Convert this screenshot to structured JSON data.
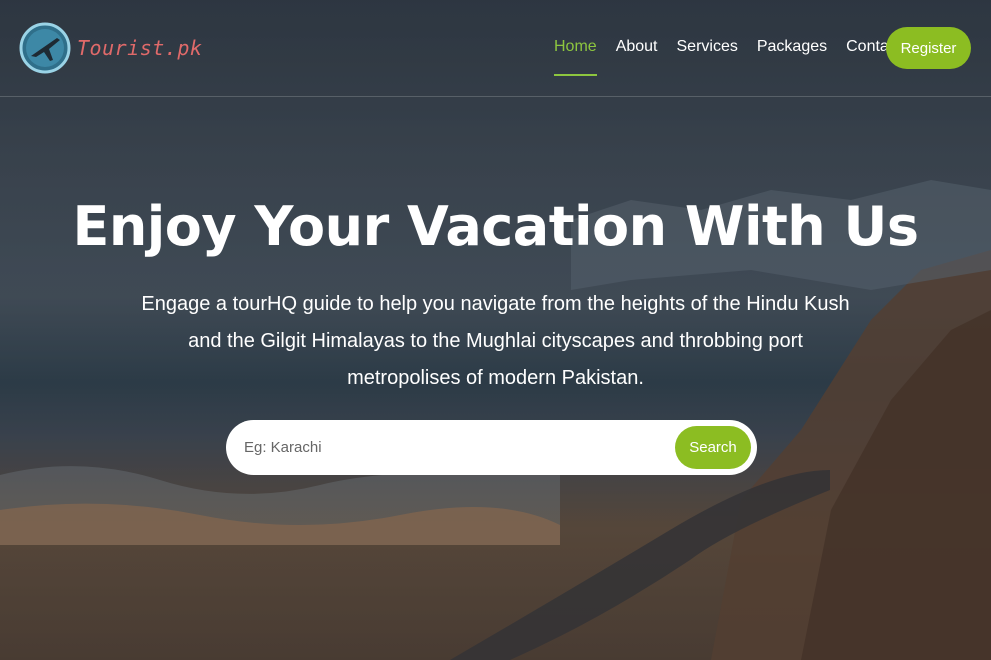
{
  "brand": {
    "name": "Tourist.pk",
    "logo_icon": "airplane-globe-icon"
  },
  "nav": {
    "items": [
      {
        "label": "Home",
        "active": true
      },
      {
        "label": "About",
        "active": false
      },
      {
        "label": "Services",
        "active": false
      },
      {
        "label": "Packages",
        "active": false
      },
      {
        "label": "Contact",
        "active": false
      }
    ],
    "register_label": "Register"
  },
  "hero": {
    "title": "Enjoy Your Vacation With Us",
    "subtitle": "Engage a tourHQ guide to help you navigate from the heights of the Hindu Kush and the Gilgit Himalayas to the Mughlai cityscapes and throbbing port metropolises of modern Pakistan."
  },
  "search": {
    "placeholder": "Eg: Karachi",
    "value": "",
    "button_label": "Search"
  },
  "colors": {
    "accent": "#8cbd22",
    "active_link": "#8dc63f",
    "logo_text": "#e06a6a"
  }
}
